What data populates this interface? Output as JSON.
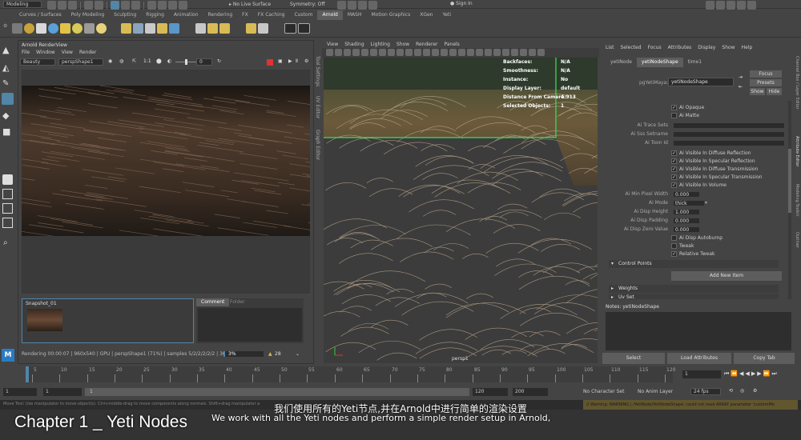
{
  "status_line": {
    "mode": "Modeling",
    "live_surface": "No Live Surface",
    "symmetry": "Symmetry: Off",
    "signin": "Sign In"
  },
  "shelf_tabs": [
    "Curves / Surfaces",
    "Poly Modeling",
    "Sculpting",
    "Rigging",
    "Animation",
    "Rendering",
    "FX",
    "FX Caching",
    "Custom",
    "Arnold",
    "MASH",
    "Motion Graphics",
    "XGen",
    "Yeti"
  ],
  "shelf_active": "Arnold",
  "renderview": {
    "title": "Arnold RenderView",
    "menu": [
      "File",
      "Window",
      "View",
      "Render"
    ],
    "aov": "Beauty",
    "camera": "perspShape1",
    "ratio": "1:1",
    "exposure": "0",
    "snapshot": "Snapshot_01",
    "tabs": [
      "Comment",
      "Folder"
    ],
    "status": "Rendering 00:00:07 | 960x540 | GPU | perspShape1 (71%) | samples 5/2/2/2/2/2 | 3665.84 MB",
    "progress_label": "3%",
    "progress_pct": 3,
    "bucket": "28"
  },
  "viewport": {
    "menu": [
      "View",
      "Shading",
      "Lighting",
      "Show",
      "Renderer",
      "Panels"
    ],
    "hud": [
      [
        "Backfaces:",
        "N/A"
      ],
      [
        "Smoothness:",
        "N/A"
      ],
      [
        "Instance:",
        "No"
      ],
      [
        "Display Layer:",
        "default"
      ],
      [
        "Distance From Camera:",
        "4.913"
      ],
      [
        "Selected Objects:",
        "1"
      ]
    ],
    "camera": "persp1"
  },
  "vertical_tabs": [
    "Tool Settings",
    "UV Editor",
    "Graph Editor"
  ],
  "right_vertical_tabs": [
    "Channel Box / Layer Editor",
    "Attribute Editor",
    "Modeling Toolkit",
    "Outliner"
  ],
  "attr_editor": {
    "menu": [
      "List",
      "Selected",
      "Focus",
      "Attributes",
      "Display",
      "Show",
      "Help"
    ],
    "tabs": [
      "yetiNode",
      "yetiNodeShape",
      "time1"
    ],
    "node_label": "pgYetiMaya:",
    "node_name": "yetiNodeShape",
    "buttons": [
      "Focus",
      "Presets",
      "Show",
      "Hide"
    ],
    "checks_top": [
      {
        "label": "Ai Opaque",
        "checked": true
      },
      {
        "label": "Ai Matte",
        "checked": false
      }
    ],
    "fields": [
      {
        "label": "Ai Trace Sets",
        "value": ""
      },
      {
        "label": "Ai Sss Setname",
        "value": ""
      },
      {
        "label": "Ai Toon Id",
        "value": ""
      }
    ],
    "visibility": [
      {
        "label": "Ai Visible In Diffuse Reflection",
        "checked": true
      },
      {
        "label": "Ai Visible In Specular Reflection",
        "checked": true
      },
      {
        "label": "Ai Visible In Diffuse Transmission",
        "checked": true
      },
      {
        "label": "Ai Visible In Specular Transmission",
        "checked": true
      },
      {
        "label": "Ai Visible In Volume",
        "checked": true
      }
    ],
    "numeric": [
      {
        "label": "Ai Min Pixel Width",
        "value": "0.000"
      },
      {
        "label": "Ai Mode",
        "value": "thick"
      },
      {
        "label": "Ai Disp Height",
        "value": "1.000"
      },
      {
        "label": "Ai Disp Padding",
        "value": "0.000"
      },
      {
        "label": "Ai Disp Zero Value",
        "value": "0.000"
      }
    ],
    "checks_bottom": [
      {
        "label": "Ai Disp Autobump",
        "checked": false
      },
      {
        "label": "Tweak",
        "checked": false
      },
      {
        "label": "Relative Tweak",
        "checked": true
      }
    ],
    "section_control": "Control Points",
    "add_item": "Add New Item",
    "section_weights": "Weights",
    "section_uv": "Uv Set",
    "notes": "Notes:  yetiNodeShape",
    "footer": [
      "Select",
      "Load Attributes",
      "Copy Tab"
    ]
  },
  "timeline": {
    "ticks": [
      "5",
      "10",
      "15",
      "20",
      "25",
      "30",
      "35",
      "40",
      "45",
      "50",
      "55",
      "60",
      "65",
      "70",
      "75",
      "80",
      "85",
      "90",
      "95",
      "100",
      "105",
      "110",
      "115",
      "120"
    ],
    "current": "1"
  },
  "range": {
    "start": "1",
    "start2": "1",
    "range_label": "1",
    "end_inner": "120",
    "end": "120",
    "end2": "200",
    "char_set": "No Character Set",
    "anim_layer": "No Anim Layer",
    "fps": "24 fps"
  },
  "help_line": "Move Tool: Use manipulator to move object(s). Ctrl+middle-drag to move components along normals. Shift+drag manipulator axis",
  "warning": "// Warning: WARNING | /YetiNode/YetiNodeShape: could not read ARRAY parameter 'customMo",
  "subtitle_cn": "我们使用所有的Yeti节点,并在Arnold中进行简单的渲染设置",
  "subtitle_en": "We work with all the Yeti nodes and perform a simple render setup in Arnold,",
  "chapter": "Chapter 1 _ Yeti Nodes",
  "colors": {
    "accent": "#5285a6",
    "hud_green": "#3ee05a",
    "bg": "#444444",
    "panel": "#2b2b2b"
  }
}
